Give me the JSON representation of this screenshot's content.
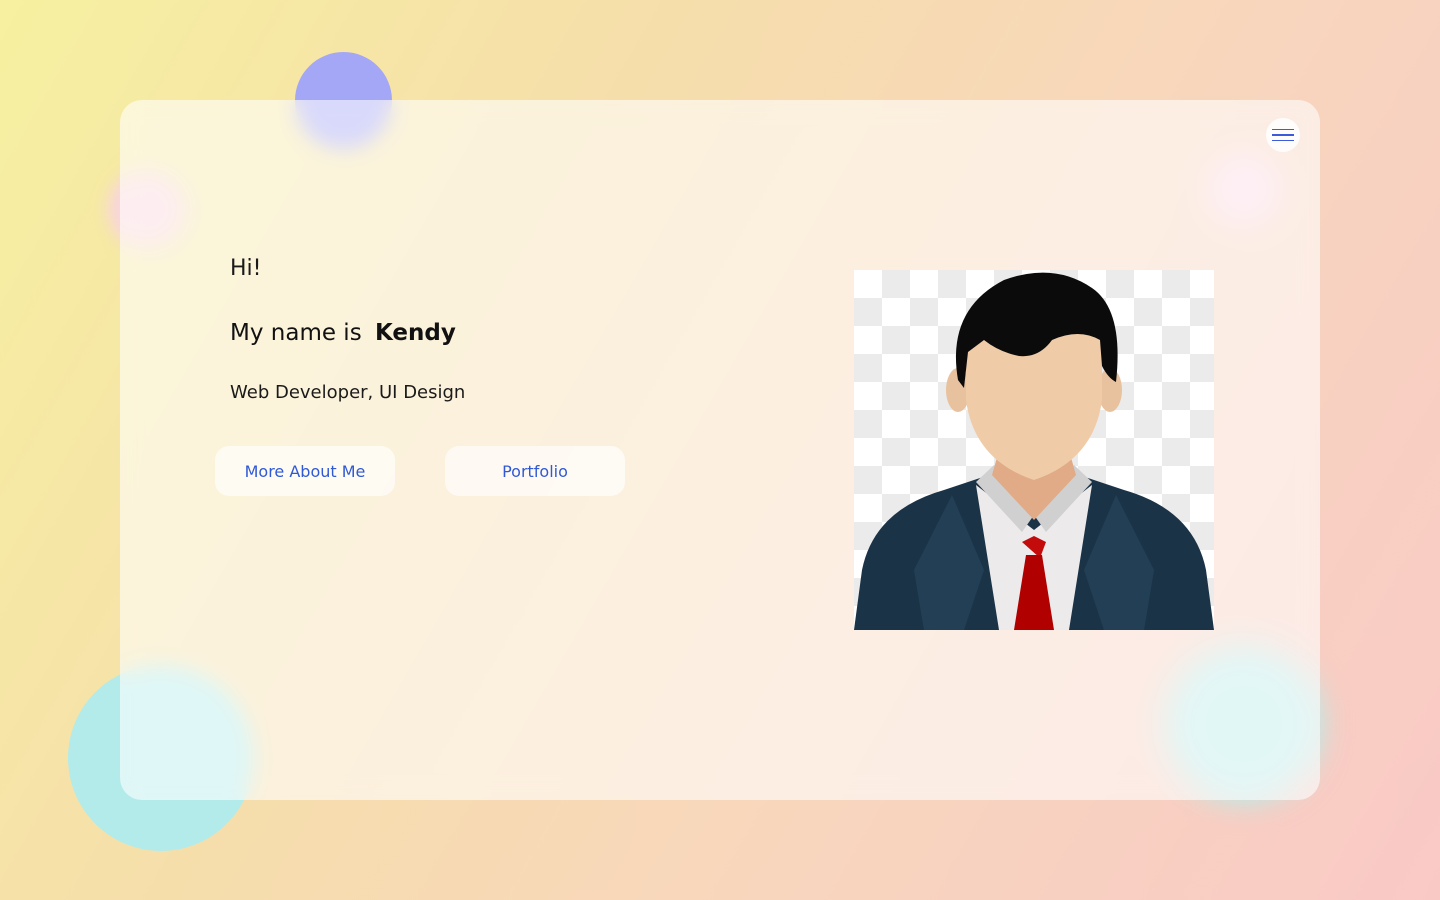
{
  "hero": {
    "greeting": "Hi!",
    "name_prefix": "My name is",
    "name": "Kendy",
    "role": "Web Developer, UI Design"
  },
  "buttons": {
    "about_label": "More About Me",
    "portfolio_label": "Portfolio"
  },
  "menu": {
    "icon": "hamburger-menu-icon"
  },
  "avatar": {
    "icon": "businessman-avatar-illustration"
  },
  "colors": {
    "accent": "#3059d6",
    "bg_start": "#f6f0a0",
    "bg_end": "#f9c9c6",
    "blob_purple": "#a4a6f6",
    "blob_cyan": "#b2ebea",
    "tie": "#b10000",
    "suit": "#1b3347"
  }
}
